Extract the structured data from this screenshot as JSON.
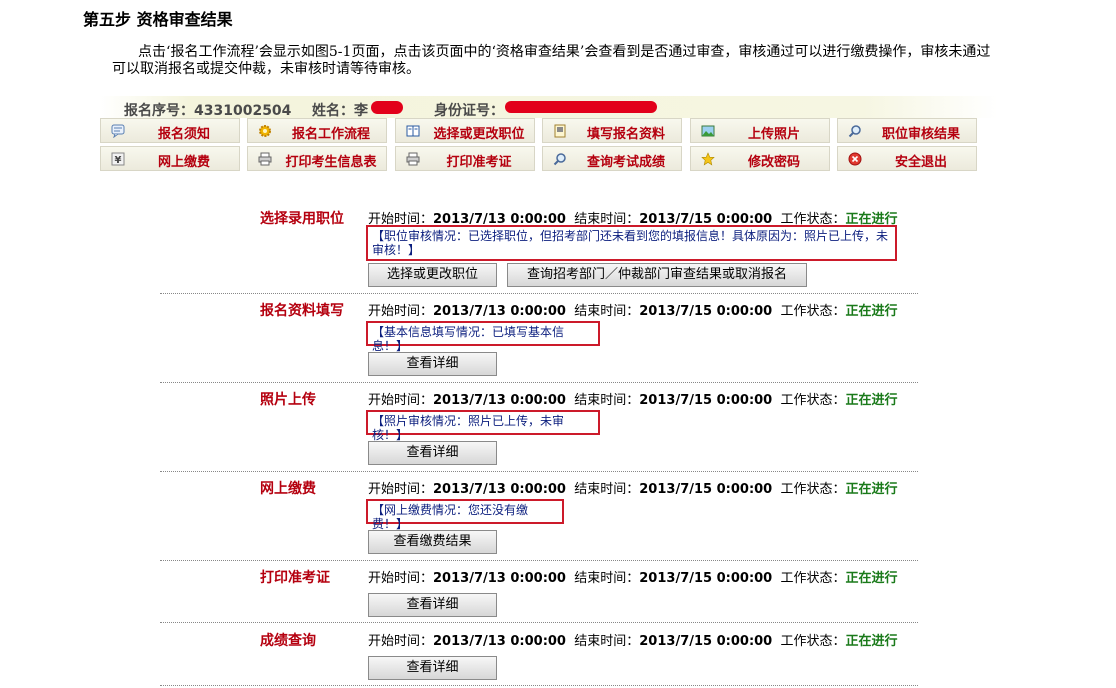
{
  "step_title": "第五步 资格审查结果",
  "intro_text": "点击‘报名工作流程’会显示如图5-1页面，点击该页面中的‘资格审查结果’会查看到是否通过审查，审核通过可以进行缴费操作，审核未通过可以取消报名或提交仲裁，未审核时请等待审核。",
  "info": {
    "serial_label": "报名序号：",
    "serial_value": "4331002504",
    "name_label": "姓名：",
    "name_value": "李",
    "id_label": "身份证号："
  },
  "nav": [
    {
      "label": "报名须知",
      "icon": "speech-bubble-icon"
    },
    {
      "label": "报名工作流程",
      "icon": "gear-icon"
    },
    {
      "label": "选择或更改职位",
      "icon": "book-icon"
    },
    {
      "label": "填写报名资料",
      "icon": "form-icon"
    },
    {
      "label": "上传照片",
      "icon": "image-icon"
    },
    {
      "label": "职位审核结果",
      "icon": "magnifier-icon"
    },
    {
      "label": "网上缴费",
      "icon": "yen-icon"
    },
    {
      "label": "打印考生信息表",
      "icon": "printer-icon"
    },
    {
      "label": "打印准考证",
      "icon": "printer-icon"
    },
    {
      "label": "查询考试成绩",
      "icon": "magnifier-icon"
    },
    {
      "label": "修改密码",
      "icon": "star-icon"
    },
    {
      "label": "安全退出",
      "icon": "exit-icon"
    }
  ],
  "common": {
    "start_label": "开始时间：",
    "end_label": "结束时间：",
    "status_label": "工作状态：",
    "start_value": "2013/7/13 0:00:00",
    "end_value": "2013/7/15 0:00:00",
    "status_value": "正在进行"
  },
  "sections": [
    {
      "title": "选择录用职位",
      "notice": "【职位审核情况：已选择职位，但招考部门还未看到您的填报信息！具体原因为：照片已上传，未审核！】",
      "buttons": [
        "选择或更改职位",
        "查询招考部门／仲裁部门审查结果或取消报名"
      ]
    },
    {
      "title": "报名资料填写",
      "notice": "【基本信息填写情况：已填写基本信息！】",
      "buttons": [
        "查看详细"
      ]
    },
    {
      "title": "照片上传",
      "notice": "【照片审核情况：照片已上传，未审核！】",
      "buttons": [
        "查看详细"
      ]
    },
    {
      "title": "网上缴费",
      "notice": "【网上缴费情况：您还没有缴费！】",
      "buttons": [
        "查看缴费结果"
      ]
    },
    {
      "title": "打印准考证",
      "buttons": [
        "查看详细"
      ]
    },
    {
      "title": "成绩查询",
      "buttons": [
        "查看详细"
      ]
    }
  ],
  "colors": {
    "accent_red": "#b5000f",
    "status_green": "#1a7a1a",
    "notice_blue": "#0b1e7e",
    "highlight_box": "#cc1a2a"
  }
}
